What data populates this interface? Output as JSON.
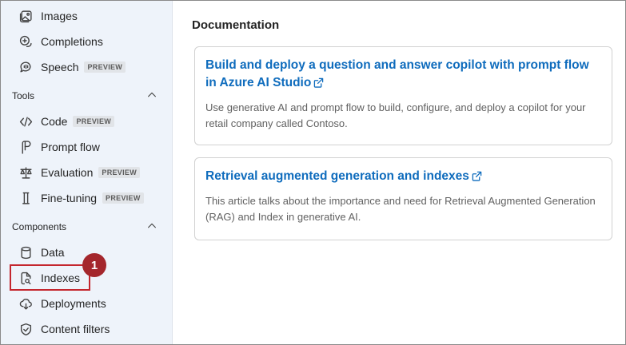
{
  "sidebar": {
    "items_top": [
      {
        "label": "Images",
        "icon": "images-icon"
      },
      {
        "label": "Completions",
        "icon": "completions-icon"
      },
      {
        "label": "Speech",
        "icon": "speech-icon",
        "badge": "PREVIEW"
      }
    ],
    "tools_section": {
      "label": "Tools"
    },
    "tools_items": [
      {
        "label": "Code",
        "icon": "code-icon",
        "badge": "PREVIEW"
      },
      {
        "label": "Prompt flow",
        "icon": "prompt-flow-icon"
      },
      {
        "label": "Evaluation",
        "icon": "scale-icon",
        "badge": "PREVIEW"
      },
      {
        "label": "Fine-tuning",
        "icon": "flask-icon",
        "badge": "PREVIEW"
      }
    ],
    "components_section": {
      "label": "Components"
    },
    "components_items": [
      {
        "label": "Data",
        "icon": "database-icon"
      },
      {
        "label": "Indexes",
        "icon": "indexes-icon"
      },
      {
        "label": "Deployments",
        "icon": "cloud-icon"
      },
      {
        "label": "Content filters",
        "icon": "shield-icon"
      }
    ]
  },
  "annotation": {
    "marker": "1",
    "color": "#a4262c"
  },
  "main": {
    "heading": "Documentation",
    "cards": [
      {
        "title": "Build and deploy a question and answer copilot with prompt flow in Azure AI Studio",
        "description": "Use generative AI and prompt flow to build, configure, and deploy a copilot for your retail company called Contoso."
      },
      {
        "title": "Retrieval augmented generation and indexes",
        "description": "This article talks about the importance and need for Retrieval Augmented Generation (RAG) and Index in generative AI."
      }
    ]
  },
  "colors": {
    "link": "#0f6cbd",
    "sidebar_bg": "#eef3fa",
    "highlight": "#c4262e"
  }
}
